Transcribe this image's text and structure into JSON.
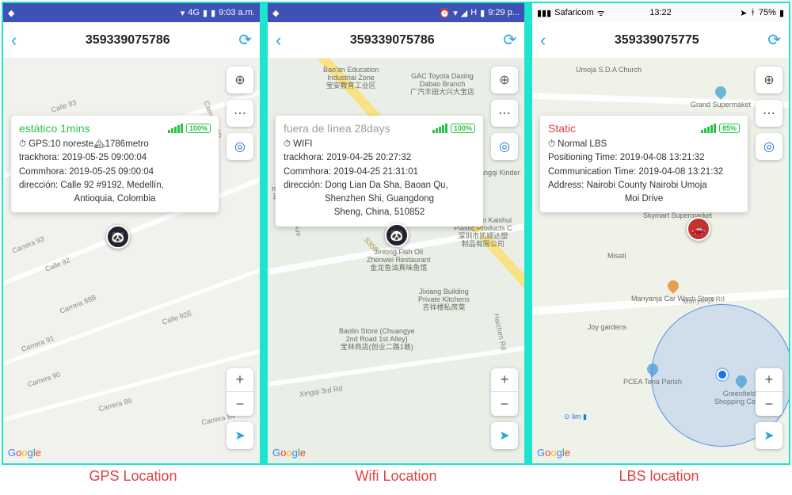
{
  "captions": [
    "GPS Location",
    "Wifi Location",
    "LBS location"
  ],
  "panels": [
    {
      "status": {
        "type": "android",
        "left_icon": "🛡",
        "network": "4G",
        "time": "9:03 a.m."
      },
      "header": {
        "title": "359339075786"
      },
      "card": {
        "status_text": "estático 1mins",
        "status_class": "stat-green",
        "battery": "100%",
        "line_mode": "GPS:10 noreste",
        "line_alt": "1786metro",
        "track": "trackhora: 2019-05-25 09:00:04",
        "comm": "Commhora: 2019-05-25 09:00:04",
        "addr1": "dirección: Calle 92 #9192, Medellín,",
        "addr2": "Antioquia, Colombia"
      },
      "marker_emoji": "🐼"
    },
    {
      "status": {
        "type": "android",
        "left_icon": "🛡",
        "network": "H",
        "time": "9:29 p..."
      },
      "header": {
        "title": "359339075786"
      },
      "card": {
        "status_text": "fuera de línea 28days",
        "status_class": "stat-gray",
        "battery": "100%",
        "line_mode": "WIFI",
        "line_alt": "",
        "track": "trackhora: 2019-04-25 20:27:32",
        "comm": "Commhora: 2019-04-25 21:31:01",
        "addr1": "dirección: Dong Lian Da Sha, Baoan Qu,",
        "addr2": "Shenzhen Shi, Guangdong",
        "addr3": "Sheng, China, 510852"
      },
      "marker_emoji": "🐼",
      "pois": [
        "Bao'an Education Industrial Zone 宝安教育工业区",
        "GAC Toyota Daxing Dabao Branch 广汽丰田大兴大宝店",
        "Jinlong Fish Oil Zhenwei Restaurant 金龙鱼油真味鱼馆",
        "Jixiang Building Private Kitchens 吉祥楼私房菜",
        "Baolin Store (Chuangye 2nd Road 1st Alley) 宝林商店(创业二路1巷)",
        "Shenzhen Kaishui Plastic Products Co. 深圳市凯顺达塑制品有限公司"
      ]
    },
    {
      "status": {
        "type": "ios",
        "carrier": "Safaricom",
        "time": "13:22",
        "battery": "75%"
      },
      "header": {
        "title": "359339075775"
      },
      "card": {
        "status_text": "Static",
        "status_class": "stat-red",
        "battery": "85%",
        "line_mode": "Normal  LBS",
        "line_alt": "",
        "track": "Positioning Time: 2019-04-08 13:21:32",
        "comm": "Communication Time: 2019-04-08 13:21:32",
        "addr1": "Address: Nairobi County Nairobi Umoja",
        "addr2": "Moi Drive"
      },
      "marker_emoji": "🚗",
      "pois": [
        "Umoja S.D.A Church",
        "Grand Supermaket",
        "Skymart Supermarket",
        "Misati",
        "Manyanja Car Wash Store",
        "Joy gardens",
        "PCEA Tena Parish",
        "Greenfields Shopping Centre"
      ]
    }
  ]
}
